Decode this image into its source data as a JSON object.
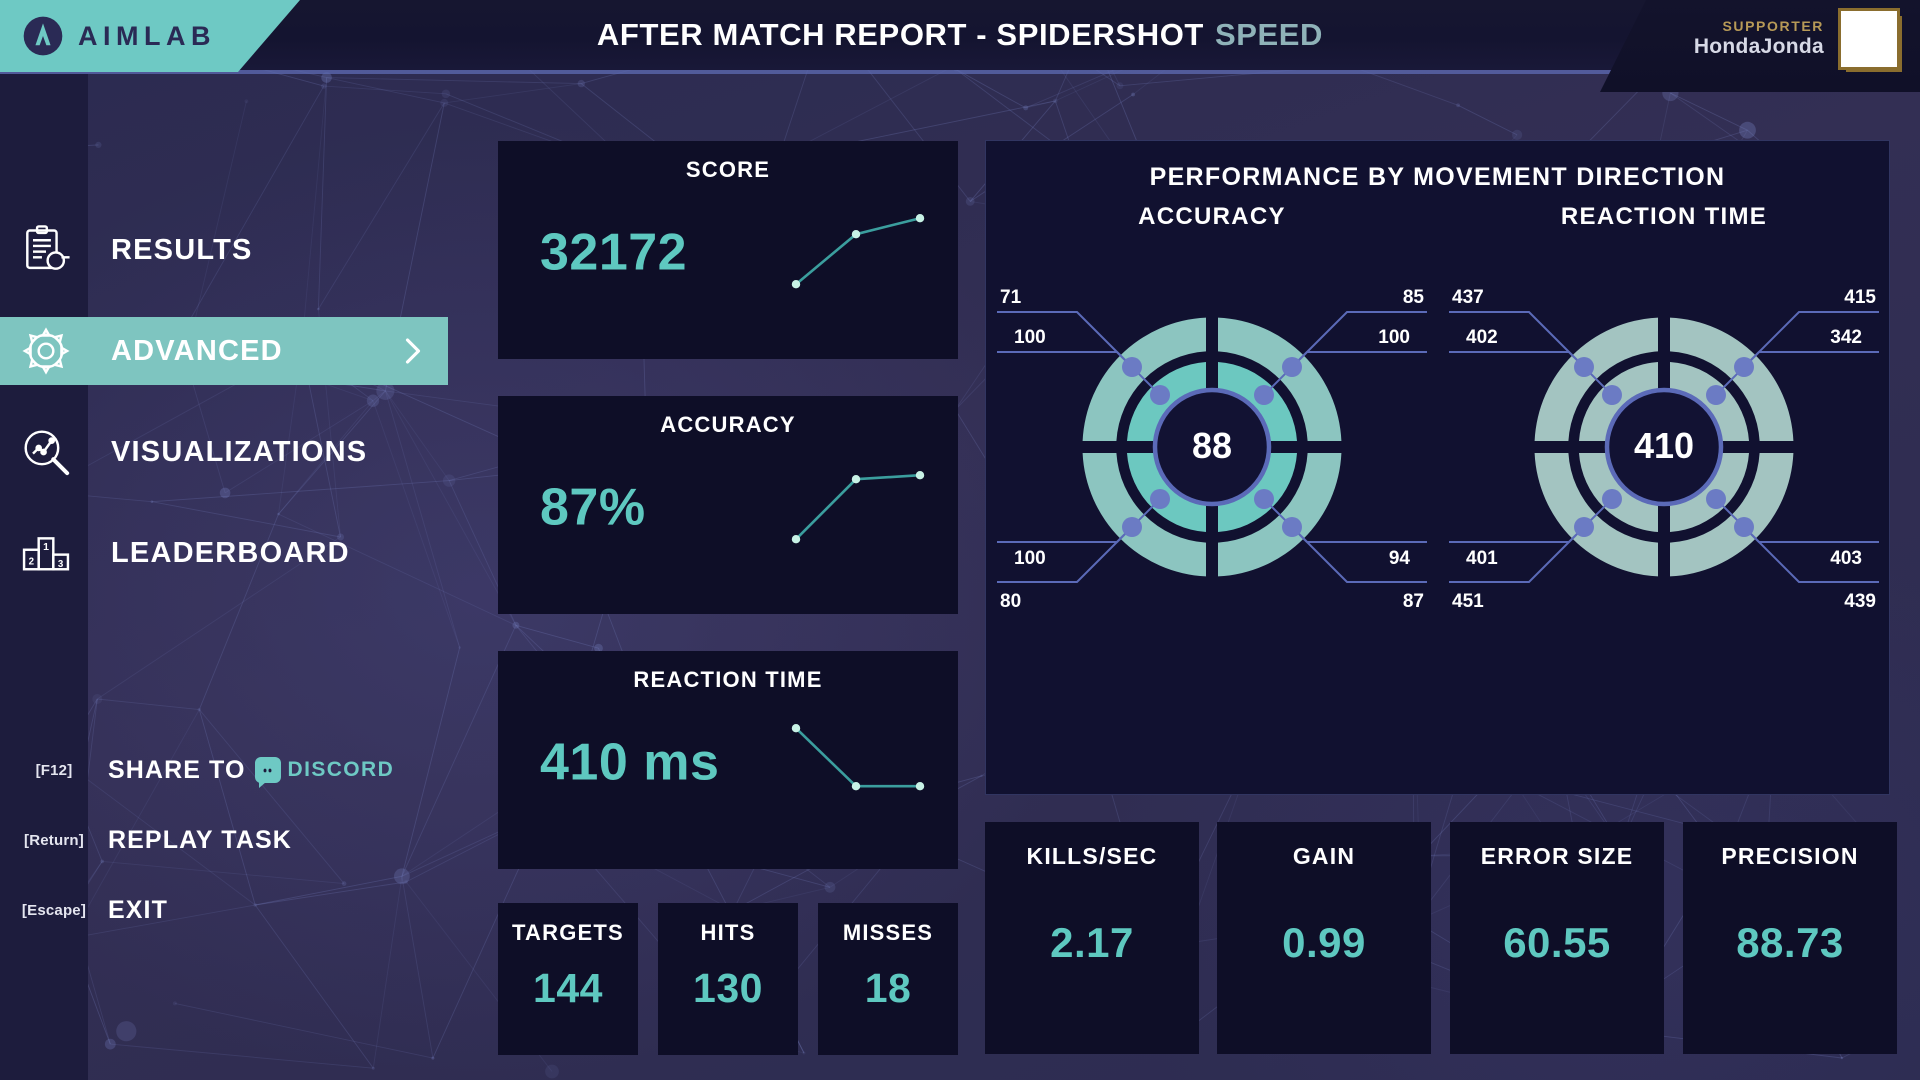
{
  "header": {
    "logo_text": "AIMLAB",
    "title": "AFTER MATCH REPORT - SPIDERSHOT",
    "title_mode": "SPEED",
    "supporter_label": "SUPPORTER",
    "supporter_name": "HondaJonda"
  },
  "sidebar": {
    "items": [
      {
        "label": "RESULTS",
        "icon": "clipboard-icon",
        "active": false
      },
      {
        "label": "ADVANCED",
        "icon": "gear-icon",
        "active": true
      },
      {
        "label": "VISUALIZATIONS",
        "icon": "magnifier-chart-icon",
        "active": false
      },
      {
        "label": "LEADERBOARD",
        "icon": "podium-icon",
        "active": false
      }
    ],
    "actions": [
      {
        "key": "[F12]",
        "label": "SHARE TO",
        "badge": "DISCORD",
        "icon": "discord-icon"
      },
      {
        "key": "[Return]",
        "label": "REPLAY TASK",
        "badge": "",
        "icon": ""
      },
      {
        "key": "[Escape]",
        "label": "EXIT",
        "badge": "",
        "icon": ""
      }
    ]
  },
  "summary_cards": [
    {
      "title": "SCORE",
      "value": "32172"
    },
    {
      "title": "ACCURACY",
      "value": "87%"
    },
    {
      "title": "REACTION TIME",
      "value": "410 ms"
    }
  ],
  "count_cards": [
    {
      "title": "TARGETS",
      "value": "144"
    },
    {
      "title": "HITS",
      "value": "130"
    },
    {
      "title": "MISSES",
      "value": "18"
    }
  ],
  "stat_cards": [
    {
      "title": "KILLS/SEC",
      "value": "2.17"
    },
    {
      "title": "GAIN",
      "value": "0.99"
    },
    {
      "title": "ERROR SIZE",
      "value": "60.55"
    },
    {
      "title": "PRECISION",
      "value": "88.73"
    }
  ],
  "panel": {
    "title": "PERFORMANCE BY MOVEMENT DIRECTION",
    "radials": [
      {
        "title": "ACCURACY",
        "center": "88"
      },
      {
        "title": "REACTION TIME",
        "center": "410"
      }
    ]
  },
  "colors": {
    "accent_teal": "#6ec9c4",
    "value_teal": "#5ec8c0",
    "ring_outer": "#8cc5c0",
    "ring_inner": "#6cc8c0",
    "ring_outer_rt": "#a3c4c1",
    "ring_inner_rt": "#a3c4c1",
    "node_blue": "#6b7bc4",
    "card_bg": "#0e0e27",
    "panel_bg": "#111130",
    "page_bg": "#2e2d52",
    "topbar_bg": "#161630",
    "supporter_gold": "#b79a57"
  },
  "chart_data": [
    {
      "type": "line",
      "title": "SCORE",
      "name": "score-sparkline",
      "x": [
        0,
        1,
        2
      ],
      "values": [
        32172
      ],
      "points_norm": [
        [
          0.0,
          0.08
        ],
        [
          0.62,
          0.78
        ],
        [
          0.98,
          0.92
        ]
      ],
      "xlabel": "",
      "ylabel": "",
      "grid": false,
      "legend": "none"
    },
    {
      "type": "line",
      "title": "ACCURACY",
      "name": "accuracy-sparkline",
      "x": [
        0,
        1,
        2
      ],
      "values": [
        87
      ],
      "points_norm": [
        [
          0.0,
          0.08
        ],
        [
          0.62,
          0.9
        ],
        [
          0.98,
          0.92
        ]
      ],
      "xlabel": "",
      "ylabel": "",
      "grid": false,
      "legend": "none"
    },
    {
      "type": "line",
      "title": "REACTION TIME",
      "name": "reaction-time-sparkline",
      "x": [
        0,
        1,
        2
      ],
      "values": [
        410
      ],
      "points_norm": [
        [
          0.0,
          0.95
        ],
        [
          0.62,
          0.14
        ],
        [
          0.98,
          0.14
        ]
      ],
      "xlabel": "",
      "ylabel": "",
      "grid": false,
      "legend": "none"
    },
    {
      "type": "radial",
      "title": "ACCURACY",
      "name": "accuracy-by-direction",
      "center_label": "88",
      "rings": [
        "outer",
        "inner"
      ],
      "quadrants": [
        "top-left",
        "top-right",
        "bottom-right",
        "bottom-left"
      ],
      "series": [
        {
          "name": "outer",
          "values": [
            71,
            85,
            87,
            80
          ]
        },
        {
          "name": "inner",
          "values": [
            100,
            100,
            94,
            100
          ]
        }
      ],
      "labels": {
        "outer_top_left": "71",
        "outer_top_right": "85",
        "outer_bottom_right": "87",
        "outer_bottom_left": "80",
        "inner_top_left": "100",
        "inner_top_right": "100",
        "inner_bottom_right": "94",
        "inner_bottom_left": "100"
      },
      "ylim": [
        0,
        100
      ],
      "units": "%"
    },
    {
      "type": "radial",
      "title": "REACTION TIME",
      "name": "reaction-time-by-direction",
      "center_label": "410",
      "rings": [
        "outer",
        "inner"
      ],
      "quadrants": [
        "top-left",
        "top-right",
        "bottom-right",
        "bottom-left"
      ],
      "series": [
        {
          "name": "outer",
          "values": [
            437,
            415,
            439,
            451
          ]
        },
        {
          "name": "inner",
          "values": [
            402,
            342,
            403,
            401
          ]
        }
      ],
      "labels": {
        "outer_top_left": "437",
        "outer_top_right": "415",
        "outer_bottom_right": "439",
        "outer_bottom_left": "451",
        "inner_top_left": "402",
        "inner_top_right": "342",
        "inner_bottom_right": "403",
        "inner_bottom_left": "401"
      },
      "ylim": [
        0,
        500
      ],
      "units": "ms"
    }
  ]
}
